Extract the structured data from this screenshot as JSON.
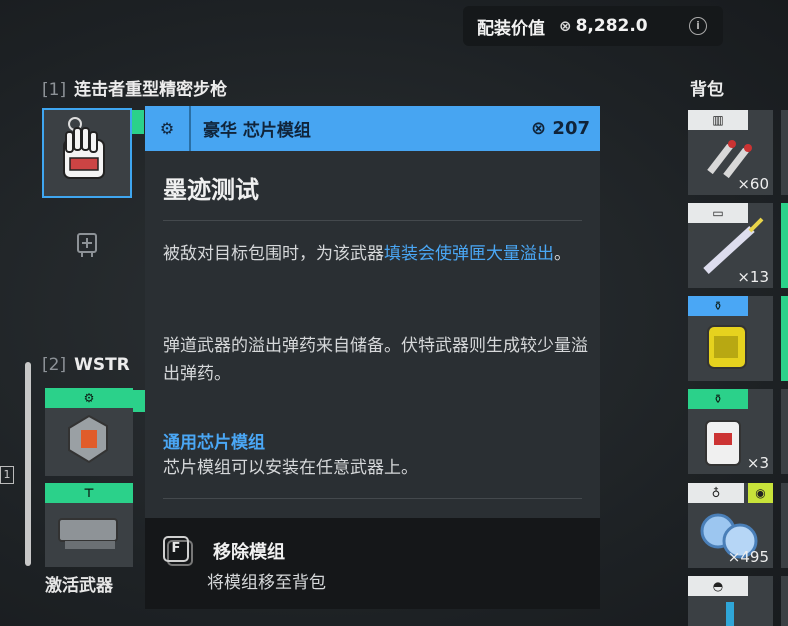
{
  "header": {
    "label": "配装价值",
    "currency_icon": "⊗",
    "amount": "8,282.0",
    "info_icon": "i"
  },
  "weapons": [
    {
      "index": "[1]",
      "name": "连击者重型精密步枪"
    },
    {
      "index": "[2]",
      "name": "WSTR"
    }
  ],
  "side_marker": "1",
  "activate_label": "激活武器",
  "inventory": {
    "title": "背包",
    "items": [
      {
        "count": "×60"
      },
      {
        "count": "×13"
      },
      {
        "count": ""
      },
      {
        "count": "×3"
      },
      {
        "count": "×495"
      }
    ]
  },
  "tooltip": {
    "category": "豪华 芯片模组",
    "price_icon": "⊗",
    "price": "207",
    "title": "墨迹测试",
    "desc1_pre": "被敌对目标包围时，为该武器",
    "desc1_hl": "填装会使弹匣大量溢出",
    "desc1_post": "。",
    "desc2": "弹道武器的溢出弹药来自储备。伏特武器则生成较少量溢出弹药。",
    "sub_title": "通用芯片模组",
    "sub_desc": "芯片模组可以安装在任意武器上。",
    "action_key": "F",
    "action_title": "移除模组",
    "action_desc": "将模组移至背包"
  }
}
